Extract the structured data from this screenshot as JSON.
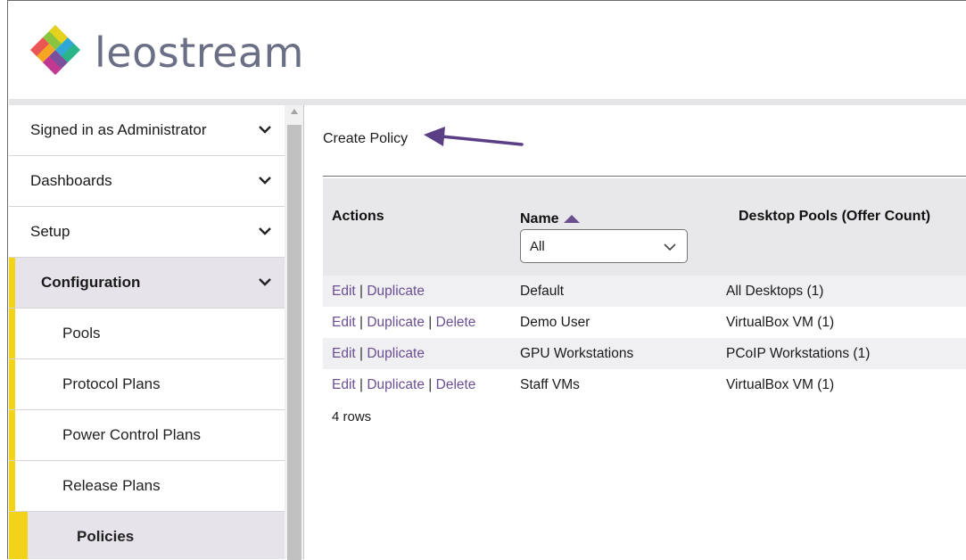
{
  "brand": {
    "name": "leostream"
  },
  "sidebar": {
    "items": [
      {
        "label": "Signed in as Administrator",
        "icon": "chevron-down-icon"
      },
      {
        "label": "Dashboards",
        "icon": "chevron-down-icon"
      },
      {
        "label": "Setup",
        "icon": "chevron-down-icon"
      },
      {
        "label": "Configuration",
        "icon": "chevron-down-icon"
      }
    ],
    "subitems": [
      {
        "label": "Pools"
      },
      {
        "label": "Protocol Plans"
      },
      {
        "label": "Power Control Plans"
      },
      {
        "label": "Release Plans"
      },
      {
        "label": "Policies"
      }
    ]
  },
  "main": {
    "create_link": "Create Policy",
    "table": {
      "headers": {
        "actions": "Actions",
        "name": "Name",
        "pools": "Desktop Pools (Offer Count)"
      },
      "filter_value": "All",
      "rows": [
        {
          "name": "Default",
          "pools": "All Desktops (1)",
          "actions": [
            "Edit",
            "Duplicate"
          ]
        },
        {
          "name": "Demo User",
          "pools": "VirtualBox VM (1)",
          "actions": [
            "Edit",
            "Duplicate",
            "Delete"
          ]
        },
        {
          "name": "GPU Workstations",
          "pools": "PCoIP Workstations (1)",
          "actions": [
            "Edit",
            "Duplicate"
          ]
        },
        {
          "name": "Staff VMs",
          "pools": "VirtualBox VM (1)",
          "actions": [
            "Edit",
            "Duplicate",
            "Delete"
          ]
        }
      ],
      "row_count": "4 rows"
    }
  },
  "colors": {
    "accent": "#6b4f93",
    "sidebar_highlight": "#f3d31a",
    "active_bg": "#e6e3ea"
  }
}
